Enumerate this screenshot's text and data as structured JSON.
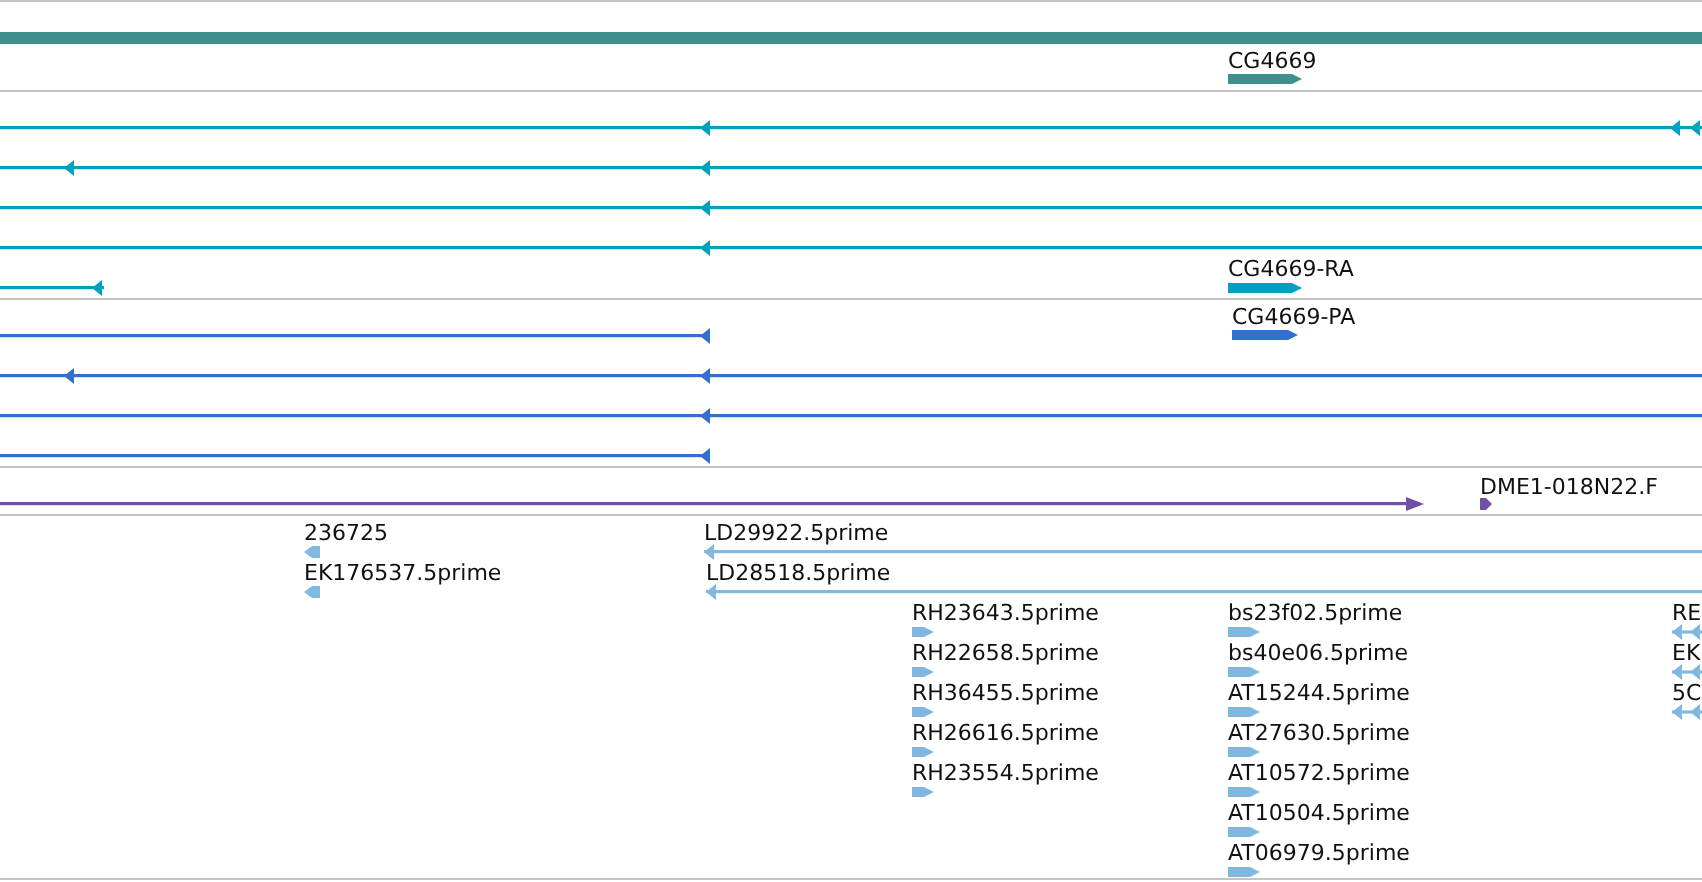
{
  "tracks": [
    {
      "kind": "gene",
      "labels": [
        "CG4669"
      ]
    },
    {
      "kind": "transcript",
      "labels": [
        "CG4669-RA"
      ]
    },
    {
      "kind": "protein",
      "labels": [
        "CG4669-PA"
      ]
    },
    {
      "kind": "clone",
      "labels": [
        "DME1-018N22.F"
      ]
    },
    {
      "kind": "est",
      "labels": [
        "236725",
        "EK176537.5prime",
        "LD29922.5prime",
        "LD28518.5prime",
        "RH23643.5prime",
        "RH22658.5prime",
        "RH36455.5prime",
        "RH26616.5prime",
        "RH23554.5prime",
        "bs23f02.5prime",
        "bs40e06.5prime",
        "AT15244.5prime",
        "AT27630.5prime",
        "AT10572.5prime",
        "AT10504.5prime",
        "AT06979.5prime",
        "RE",
        "EK",
        "5C"
      ]
    }
  ]
}
